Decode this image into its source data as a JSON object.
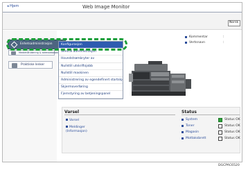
{
  "window": {
    "title": "Web Image Monitor",
    "home_link": "Hjem"
  },
  "language_select": {
    "value": "Norsk"
  },
  "sidebar": {
    "device_management": "Enhetsadministrasjon",
    "address_book": "Mediehåndtering & adressebokentry",
    "favorites": "Praktiske lenker"
  },
  "menu": {
    "items": [
      {
        "label": "Konfigurasjon"
      },
      {
        "label": "Sentral administrasjon"
      },
      {
        "label": "Hovedstrømbryter av"
      },
      {
        "label": "Nullstill utskriftsjobb"
      },
      {
        "label": "Nullstill maskinen"
      },
      {
        "label": "Administrering av egendefinert startskjerm"
      },
      {
        "label": "Skjermoverføring"
      },
      {
        "label": "Fjernstyring av betjeningspanel"
      }
    ]
  },
  "device_info": {
    "rows": [
      {
        "key": "Kommentar",
        "colon": ":"
      },
      {
        "key": "Vertsnavn",
        "colon": ":"
      }
    ]
  },
  "alerts": {
    "title": "Varsel",
    "items": [
      {
        "label": "Varsel"
      },
      {
        "label": "Meldinger (Informasjon)"
      }
    ]
  },
  "status": {
    "title": "Status",
    "rows": [
      {
        "label": "System",
        "value": "Status OK"
      },
      {
        "label": "Toner",
        "value": "Status OK"
      },
      {
        "label": "Magasin",
        "value": "Status OK"
      },
      {
        "label": "Mottaksbrett",
        "value": "Status OK"
      }
    ]
  },
  "figure_code": "DGCPAC6520",
  "colors": {
    "highlight": "#1c9e3a",
    "selected": "#2e5cb0",
    "active_button": "#4d6581"
  }
}
